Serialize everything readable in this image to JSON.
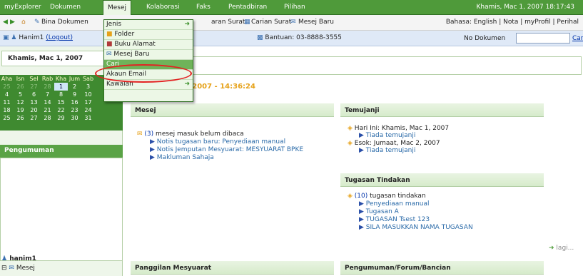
{
  "menubar": {
    "items": [
      "myExplorer",
      "Dokumen",
      "Mesej",
      "Kolaborasi",
      "Faks",
      "Pentadbiran",
      "Pilihan"
    ],
    "clock": "Khamis, Mac 1, 2007 18:17:43"
  },
  "toolbar": {
    "bina_dokumen": "Bina Dokumen",
    "keluaran_surat": "aran Surat",
    "carian_surat": "Carian Surat",
    "mesej_baru": "Mesej Baru",
    "right": "Bahasa: English | Nota | myProfil | Perihal"
  },
  "userbar": {
    "user": "Hanim1",
    "logout": "(Logout)",
    "bantuan": "Bantuan: 03-8888-3555",
    "no_dokumen_label": "No Dokumen",
    "no_dokumen_value": "",
    "cari": "Cari"
  },
  "sidebar": {
    "date": "Khamis, Mac 1, 2007",
    "calendar": {
      "head": [
        "Aha",
        "Isn",
        "Sel",
        "Rab",
        "Kha",
        "Jum",
        "Sab"
      ],
      "rows": [
        [
          "25",
          "26",
          "27",
          "28",
          "1",
          "2",
          "3"
        ],
        [
          "4",
          "5",
          "6",
          "7",
          "8",
          "9",
          "10"
        ],
        [
          "11",
          "12",
          "13",
          "14",
          "15",
          "16",
          "17"
        ],
        [
          "18",
          "19",
          "20",
          "21",
          "22",
          "23",
          "24"
        ],
        [
          "25",
          "26",
          "27",
          "28",
          "29",
          "30",
          "31"
        ]
      ]
    },
    "pengumuman": "Pengumuman",
    "user_bottom": "hanim1",
    "mesej_bottom": "Mesej"
  },
  "dropdown": {
    "items": [
      "Jenis",
      "Folder",
      "Buku Alamat",
      "Mesej Baru",
      "Cari",
      "Akaun Email",
      "Kawalan"
    ]
  },
  "main": {
    "greeting": "Khamis, 1 Mac 2007 - 14:36:24",
    "mesej": {
      "title": "Mesej",
      "count": "(3)",
      "count_text": "mesej masuk belum dibaca",
      "links": [
        "Notis tugasan baru: Penyediaan manual",
        "Notis Jemputan Mesyuarat: MESYUARAT BPKE",
        "Makluman Sahaja"
      ]
    },
    "temujanji": {
      "title": "Temujanji",
      "today": "Hari Ini: Khamis, Mac 1, 2007",
      "today_none": "Tiada temujanji",
      "tomorrow": "Esok: Jumaat, Mac 2, 2007",
      "tomorrow_none": "Tiada temujanji"
    },
    "tugasan": {
      "title": "Tugasan Tindakan",
      "count": "(10)",
      "count_text": "tugasan tindakan",
      "links": [
        "Penyediaan manual",
        "Tugasan A",
        "TUGASAN Tsest 123",
        "SILA MASUKKAN NAMA TUGASAN"
      ],
      "more": "lagi..."
    },
    "panggilan": {
      "title": "Panggilan Mesyuarat"
    },
    "forum": {
      "title": "Pengumuman/Forum/Bancian"
    }
  }
}
